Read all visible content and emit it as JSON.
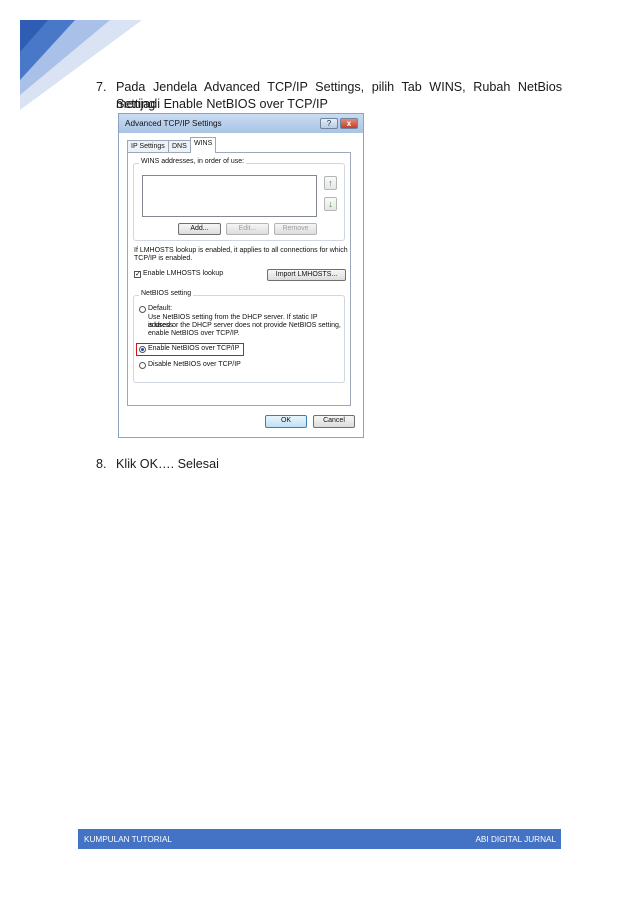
{
  "step7": {
    "number": "7.",
    "line1": "Pada Jendela Advanced TCP/IP Settings, pilih Tab WINS, Rubah NetBios Setting",
    "line2": "menjadi Enable NetBIOS over TCP/IP"
  },
  "dialog": {
    "title": "Advanced TCP/IP Settings",
    "help_button": "?",
    "close_button": "x",
    "tabs": [
      "IP Settings",
      "DNS",
      "WINS"
    ],
    "active_tab": "WINS",
    "wins_group_label": "WINS addresses, in order of use:",
    "add_button": "Add...",
    "edit_button": "Edit...",
    "remove_button": "Remove",
    "lmhosts_note_line1": "If LMHOSTS lookup is enabled, it applies to all connections for which",
    "lmhosts_note_line2": "TCP/IP is enabled.",
    "enable_lmhosts_label": "Enable LMHOSTS lookup",
    "enable_lmhosts_checked": true,
    "import_button": "Import LMHOSTS...",
    "netbios_group_label": "NetBIOS setting",
    "default_option": "Default:",
    "default_desc_line1": "Use NetBIOS setting from the DHCP server. If static IP address",
    "default_desc_line2": "is used or the DHCP server does not provide NetBIOS setting,",
    "default_desc_line3": "enable NetBIOS over TCP/IP.",
    "enable_netbios_option": "Enable NetBIOS over TCP/IP",
    "disable_netbios_option": "Disable NetBIOS over TCP/IP",
    "selected_netbios_option": "Enable NetBIOS over TCP/IP",
    "ok_button": "OK",
    "cancel_button": "Cancel"
  },
  "step8": {
    "number": "8.",
    "text": "Klik OK…. Selesai"
  },
  "footer": {
    "left": "KUMPULAN TUTORIAL",
    "right": "ABI DIGITAL JURNAL"
  },
  "colors": {
    "accent": "#4472c4",
    "highlight": "#d2141d"
  }
}
